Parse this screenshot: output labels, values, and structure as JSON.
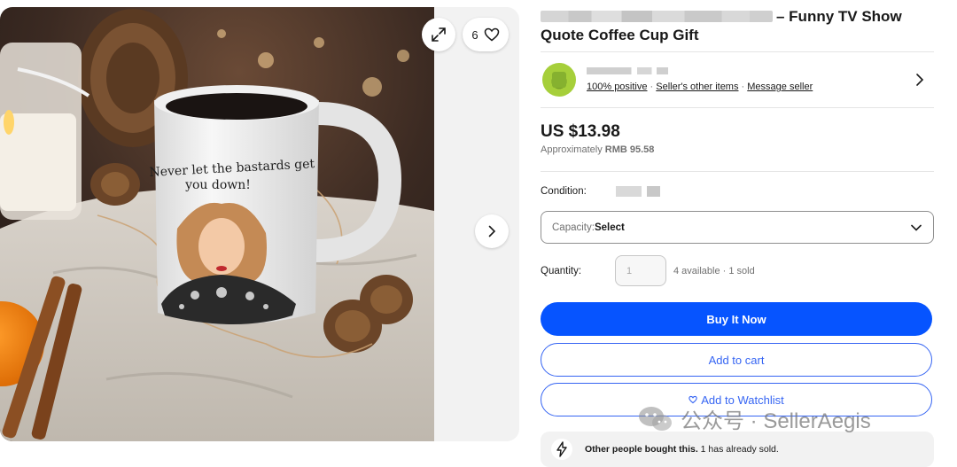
{
  "listing": {
    "title_line1_suffix": "– Funny TV Show",
    "title_line2": "Quote Coffee Cup Gift",
    "mug_text_line1": "Never let the bastards get",
    "mug_text_line2": "you down!"
  },
  "gallery": {
    "watch_count": "6",
    "expand_icon": "expand-icon",
    "heart_icon": "heart-icon",
    "next_icon": "chevron-right-icon"
  },
  "seller": {
    "positive_link": "100% positive",
    "sep1": " · ",
    "other_items_link": "Seller's other items",
    "sep2": " · ",
    "message_link": "Message seller"
  },
  "price": {
    "main": "US $13.98",
    "approx_label": "Approximately ",
    "approx_value": "RMB 95.58"
  },
  "condition": {
    "label": "Condition:"
  },
  "capacity": {
    "label": "Capacity: ",
    "value": "Select"
  },
  "quantity": {
    "label": "Quantity:",
    "placeholder": "1",
    "availability": "4 available · 1 sold"
  },
  "actions": {
    "buy_now": "Buy It Now",
    "add_to_cart": "Add to cart",
    "add_to_watchlist": "Add to Watchlist"
  },
  "notice": {
    "bold": "Other people bought this.",
    "text": " 1 has already sold."
  },
  "watermark": {
    "text": "公众号 · SellerAegis"
  },
  "colors": {
    "primary_blue": "#0654ff",
    "link_blue": "#3665f3",
    "text_dark": "#191919",
    "text_muted": "#707070"
  }
}
